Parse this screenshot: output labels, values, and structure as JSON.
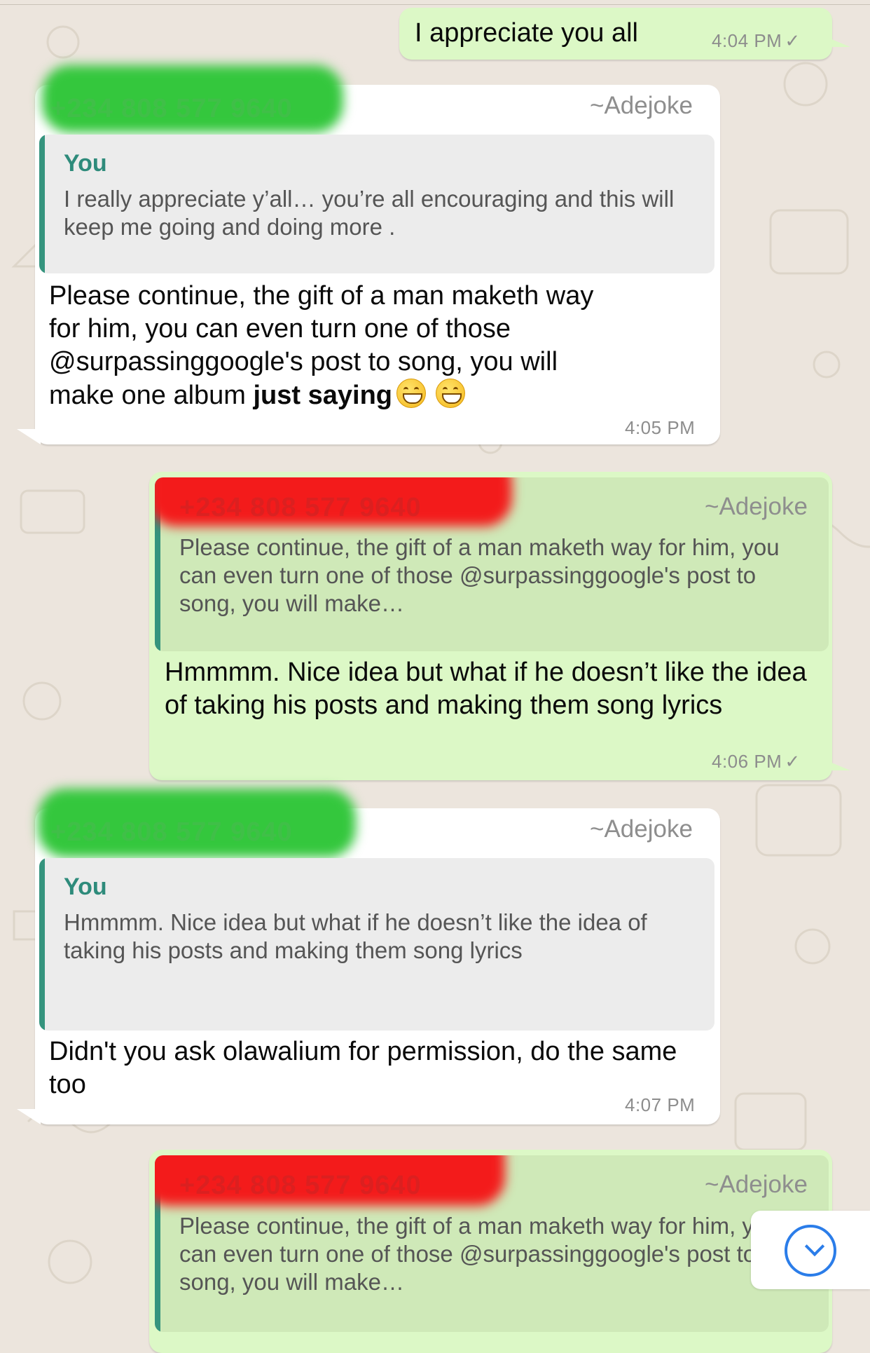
{
  "colors": {
    "background": "#ece5dd",
    "incoming_bubble": "#ffffff",
    "outgoing_bubble": "#dcf8c6",
    "quote_bar": "#35947e",
    "redact_green": "#34c73d",
    "redact_red": "#f31b1b",
    "scroll_accent": "#2b7de9"
  },
  "messages": [
    {
      "direction": "outgoing",
      "text": "I appreciate you all",
      "time": "4:04 PM",
      "status_icon": "single-check-icon"
    },
    {
      "direction": "incoming",
      "sender_number": "+234 808 577 9640",
      "sender_name": "~Adejoke",
      "quote_author": "You",
      "quote_text": "I really appreciate y’all… you’re all encouraging and this will keep me going and doing more .",
      "text_line1": "Please continue, the gift of a man maketh way",
      "text_line2": "for him, you can even turn one of those",
      "text_line3": "@surpassinggoogle's post to song, you will",
      "text_line4_start": "make one album ",
      "text_line4_bold": "just saying",
      "emoji": "grinning-face-icon",
      "time": "4:05 PM"
    },
    {
      "direction": "outgoing",
      "quote_number": "+234 808 577 9640",
      "quote_name": "~Adejoke",
      "quote_text": "Please continue, the gift of a man maketh way for him, you can even turn one of those @surpassinggoogle's post to song, you will make…",
      "text": "Hmmmm. Nice idea but what if he doesn’t like the idea of taking his posts and making them song lyrics",
      "time": "4:06 PM",
      "status_icon": "single-check-icon"
    },
    {
      "direction": "incoming",
      "sender_number": "+234 808 577 9640",
      "sender_name": "~Adejoke",
      "quote_author": "You",
      "quote_text": "Hmmmm. Nice idea but what if he doesn’t like the idea of taking his posts and making them song lyrics",
      "text": "Didn't you ask olawalium for permission, do the same too",
      "time": "4:07 PM"
    },
    {
      "direction": "outgoing",
      "quote_number": "+234 808 577 9640",
      "quote_name": "~Adejoke",
      "quote_text": "Please continue, the gift of a man maketh way for him, you can even turn one of those @surpassinggoogle's post to song, you will make…"
    }
  ],
  "scroll_button": {
    "icon": "chevron-down-icon"
  }
}
